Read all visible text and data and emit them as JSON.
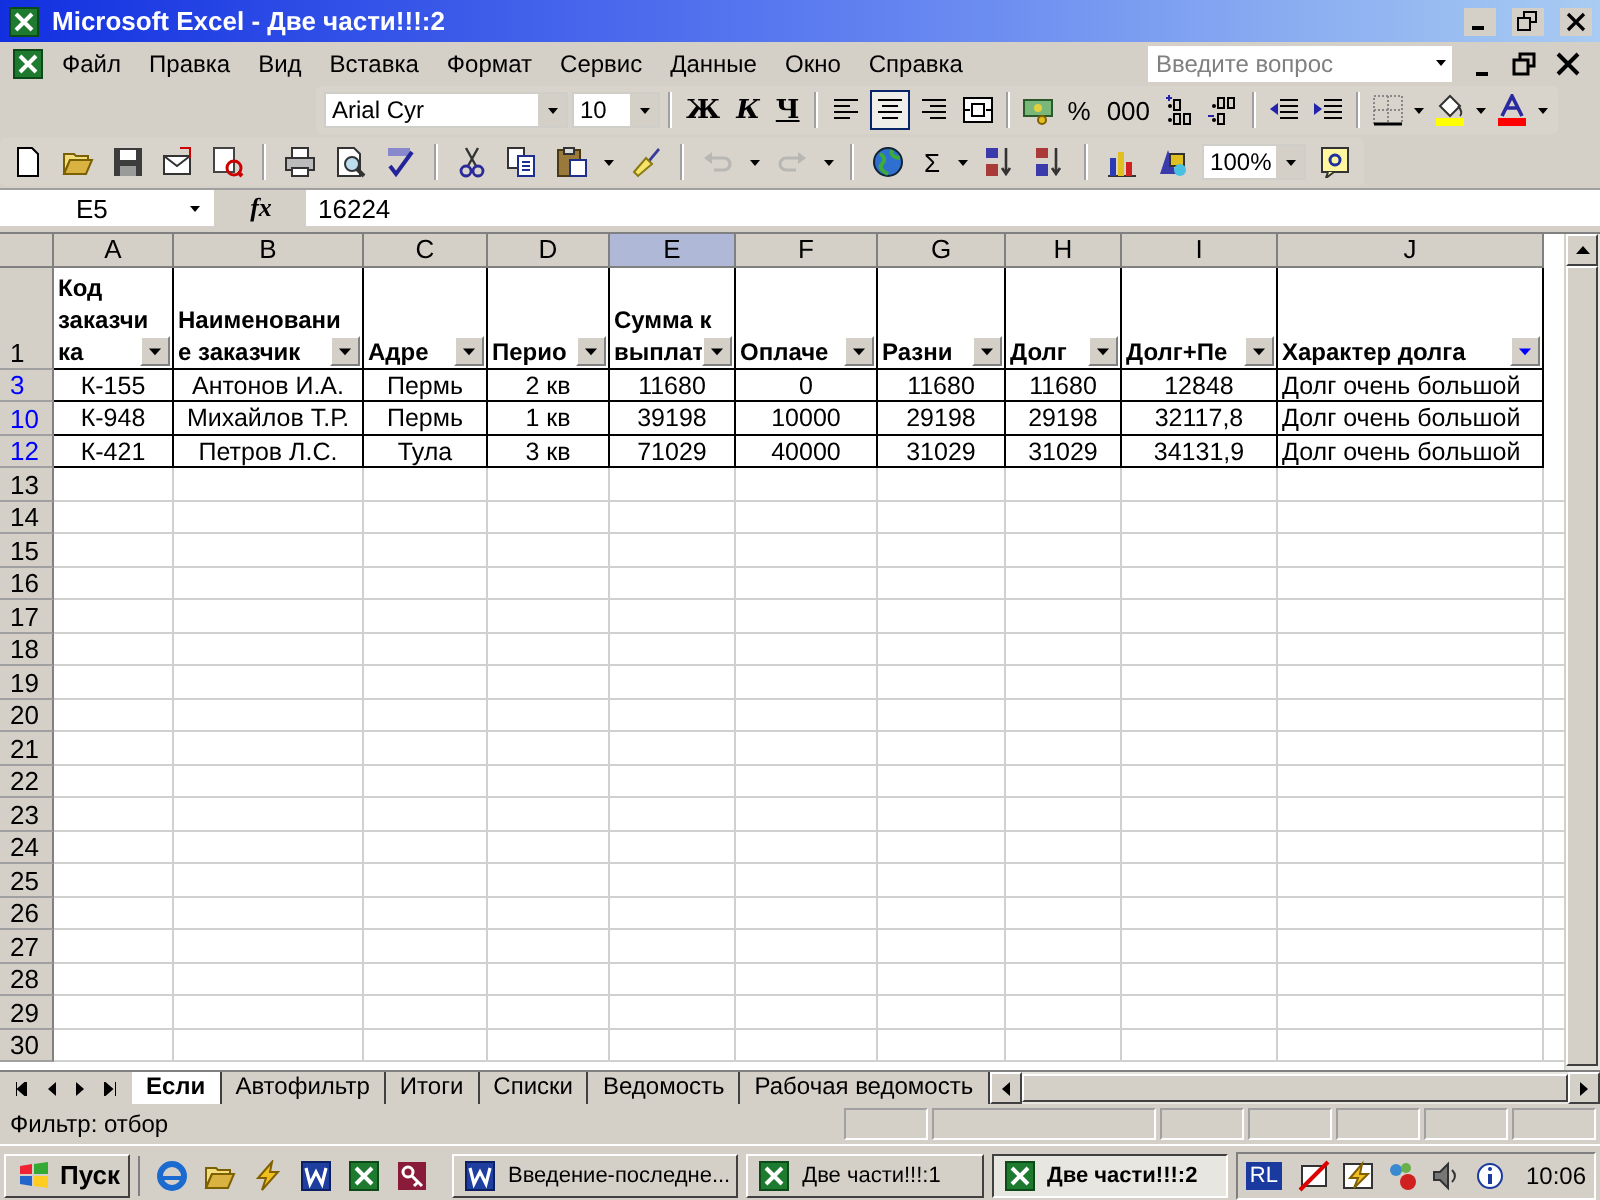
{
  "window": {
    "title": "Microsoft Excel - Две части!!!:2"
  },
  "menu": [
    "Файл",
    "Правка",
    "Вид",
    "Вставка",
    "Формат",
    "Сервис",
    "Данные",
    "Окно",
    "Справка"
  ],
  "question_box": {
    "placeholder": "Введите вопрос"
  },
  "formatting_toolbar": {
    "font": "Arial Cyr",
    "size": "10",
    "bold": "Ж",
    "italic": "К",
    "underline": "Ч",
    "percent": "%",
    "thousands": "000",
    "alignment": [
      {
        "selected": false
      },
      {
        "selected": true
      },
      {
        "selected": false
      },
      {
        "selected": false
      }
    ]
  },
  "standard_toolbar": {
    "sum": "Σ",
    "zoom": "100%",
    "history": [
      {
        "disabled": true
      },
      {
        "disabled": true
      }
    ]
  },
  "formula_bar": {
    "name_box": "E5",
    "fx": "fx",
    "value": "16224"
  },
  "columns": [
    {
      "letter": "A",
      "selected": false
    },
    {
      "letter": "B",
      "selected": false
    },
    {
      "letter": "C",
      "selected": false
    },
    {
      "letter": "D",
      "selected": false
    },
    {
      "letter": "E",
      "selected": true
    },
    {
      "letter": "F",
      "selected": false
    },
    {
      "letter": "G",
      "selected": false
    },
    {
      "letter": "H",
      "selected": false
    },
    {
      "letter": "I",
      "selected": false
    },
    {
      "letter": "J",
      "selected": false
    }
  ],
  "header_row": {
    "row": "1",
    "cells": [
      {
        "text": "Код\nзаказчи\nка",
        "filter_active": false
      },
      {
        "text": "Наименовани\nе заказчик",
        "filter_active": false
      },
      {
        "text": "Адре",
        "filter_active": false
      },
      {
        "text": "Перио",
        "filter_active": false
      },
      {
        "text": "Сумма к\nвыплат",
        "filter_active": false
      },
      {
        "text": "Оплаче",
        "filter_active": false
      },
      {
        "text": "Разни",
        "filter_active": false
      },
      {
        "text": "Долг",
        "filter_active": false
      },
      {
        "text": "Долг+Пе",
        "filter_active": false
      },
      {
        "text": "Характер долга",
        "filter_active": true
      }
    ]
  },
  "rows": [
    {
      "row": "3",
      "filtered": true,
      "cells": [
        "К-155",
        "Антонов И.А.",
        "Пермь",
        "2 кв",
        "11680",
        "0",
        "11680",
        "11680",
        "12848",
        "Долг очень большой"
      ]
    },
    {
      "row": "10",
      "filtered": true,
      "cells": [
        "К-948",
        "Михайлов Т.Р.",
        "Пермь",
        "1 кв",
        "39198",
        "10000",
        "29198",
        "29198",
        "32117,8",
        "Долг очень большой"
      ]
    },
    {
      "row": "12",
      "filtered": true,
      "cells": [
        "К-421",
        "Петров Л.С.",
        "Тула",
        "3 кв",
        "71029",
        "40000",
        "31029",
        "31029",
        "34131,9",
        "Долг очень большой"
      ]
    }
  ],
  "empty_rows": [
    "13",
    "14",
    "15",
    "16",
    "17",
    "18",
    "19",
    "20",
    "21",
    "22",
    "23",
    "24",
    "25",
    "26",
    "27",
    "28",
    "29",
    "30"
  ],
  "sheet_tabs": [
    {
      "label": "Если",
      "selected": true
    },
    {
      "label": "Автофильтр",
      "selected": false
    },
    {
      "label": "Итоги",
      "selected": false
    },
    {
      "label": "Списки",
      "selected": false
    },
    {
      "label": "Ведомость",
      "selected": false
    },
    {
      "label": "Рабочая ведомость",
      "selected": false
    }
  ],
  "status_bar": {
    "text": "Фильтр: отбор"
  },
  "taskbar": {
    "start": "Пуск",
    "tasks": [
      {
        "label": "Введение-последне...",
        "kind": "word",
        "selected": false
      },
      {
        "label": "Две части!!!:1",
        "kind": "excel",
        "selected": false
      },
      {
        "label": "Две части!!!:2",
        "kind": "excel",
        "selected": true
      }
    ],
    "language": "RL",
    "clock": "10:06"
  }
}
